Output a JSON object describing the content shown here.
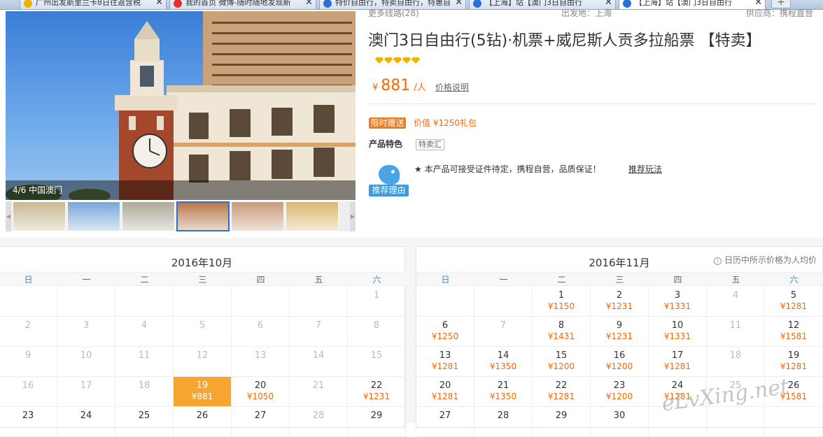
{
  "tabs": [
    {
      "label": "广州出发斯里兰卡8日往返含税",
      "icon_color": "#f0b400",
      "active": false
    },
    {
      "label": "我的首页 微博-随时随地发现新",
      "icon_color": "#e03030",
      "active": false
    },
    {
      "label": "特价自由行，特卖自由行，特惠自",
      "icon_color": "#2a6fd6",
      "active": false
    },
    {
      "label": "【上海】站【澳门3日自由行",
      "icon_color": "#2a6fd6",
      "active": false
    },
    {
      "label": "【上海】站【澳门3日自由行",
      "icon_color": "#2a6fd6",
      "active": true
    }
  ],
  "crumbs": {
    "left": "更多线路(28)",
    "mid": "出发地：上海",
    "right": "供应商：携程直营"
  },
  "gallery": {
    "caption": "4/6  中国澳门",
    "thumb_colors": [
      "#c8b890",
      "#7aa7d8",
      "#b0a89a",
      "#b8784a",
      "#c89a7a",
      "#d8b870"
    ],
    "selected_thumb": 3
  },
  "product": {
    "title": "澳门3日自由行(5钻)·机票+威尼斯人贡多拉船票  【特卖】",
    "diamond_count": 5,
    "currency": "¥",
    "price": "881",
    "unit": "/人",
    "price_note": "价格说明",
    "gift_tag": "限时赠送",
    "gift_text": "价值 ¥1250礼包",
    "feature_label": "产品特色",
    "feature_tag": "特卖汇",
    "recommend_label": "推荐理由",
    "recommend_text": "★ 本产品可接受证件待定，携程自营，品质保证！",
    "recommend_link": "推荐玩法"
  },
  "calendar": {
    "tip": "日历中所示价格为人均价",
    "weekdays": [
      "日",
      "一",
      "二",
      "三",
      "四",
      "五",
      "六"
    ],
    "months": [
      {
        "title": "2016年10月",
        "weeks": [
          [
            {
              "d": ""
            },
            {
              "d": ""
            },
            {
              "d": ""
            },
            {
              "d": ""
            },
            {
              "d": ""
            },
            {
              "d": ""
            },
            {
              "d": "1",
              "dis": true
            }
          ],
          [
            {
              "d": "2",
              "dis": true
            },
            {
              "d": "3",
              "dis": true
            },
            {
              "d": "4",
              "dis": true
            },
            {
              "d": "5",
              "dis": true
            },
            {
              "d": "6",
              "dis": true
            },
            {
              "d": "7",
              "dis": true
            },
            {
              "d": "8",
              "dis": true
            }
          ],
          [
            {
              "d": "9",
              "dis": true
            },
            {
              "d": "10",
              "dis": true
            },
            {
              "d": "11",
              "dis": true
            },
            {
              "d": "12",
              "dis": true
            },
            {
              "d": "13",
              "dis": true
            },
            {
              "d": "14",
              "dis": true
            },
            {
              "d": "15",
              "dis": true
            }
          ],
          [
            {
              "d": "16",
              "dis": true
            },
            {
              "d": "17",
              "dis": true
            },
            {
              "d": "18",
              "dis": true
            },
            {
              "d": "19",
              "p": "¥881",
              "sel": true
            },
            {
              "d": "20",
              "p": "¥1050"
            },
            {
              "d": "21",
              "dis": true
            },
            {
              "d": "22",
              "p": "¥1231"
            }
          ],
          [
            {
              "d": "23"
            },
            {
              "d": "24"
            },
            {
              "d": "25"
            },
            {
              "d": "26"
            },
            {
              "d": "27"
            },
            {
              "d": "28",
              "dis": true
            },
            {
              "d": "29"
            }
          ]
        ]
      },
      {
        "title": "2016年11月",
        "weeks": [
          [
            {
              "d": ""
            },
            {
              "d": ""
            },
            {
              "d": "1",
              "p": "¥1150"
            },
            {
              "d": "2",
              "p": "¥1231"
            },
            {
              "d": "3",
              "p": "¥1331"
            },
            {
              "d": "4",
              "dis": true
            },
            {
              "d": "5",
              "p": "¥1281"
            }
          ],
          [
            {
              "d": "6",
              "p": "¥1250"
            },
            {
              "d": "7",
              "dis": true
            },
            {
              "d": "8",
              "p": "¥1431"
            },
            {
              "d": "9",
              "p": "¥1231"
            },
            {
              "d": "10",
              "p": "¥1331"
            },
            {
              "d": "11",
              "dis": true
            },
            {
              "d": "12",
              "p": "¥1581"
            }
          ],
          [
            {
              "d": "13",
              "p": "¥1281"
            },
            {
              "d": "14",
              "p": "¥1350"
            },
            {
              "d": "15",
              "p": "¥1200"
            },
            {
              "d": "16",
              "p": "¥1200"
            },
            {
              "d": "17",
              "p": "¥1281"
            },
            {
              "d": "18",
              "dis": true
            },
            {
              "d": "19",
              "p": "¥1281"
            }
          ],
          [
            {
              "d": "20",
              "p": "¥1281"
            },
            {
              "d": "21",
              "p": "¥1350"
            },
            {
              "d": "22",
              "p": "¥1281"
            },
            {
              "d": "23",
              "p": "¥1200"
            },
            {
              "d": "24",
              "p": "¥1281"
            },
            {
              "d": "25",
              "dis": true
            },
            {
              "d": "26",
              "p": "¥1581"
            }
          ],
          [
            {
              "d": "27"
            },
            {
              "d": "28"
            },
            {
              "d": "29"
            },
            {
              "d": "30"
            },
            {
              "d": ""
            },
            {
              "d": ""
            },
            {
              "d": ""
            }
          ]
        ]
      }
    ]
  },
  "watermark": "eLvXing.net"
}
